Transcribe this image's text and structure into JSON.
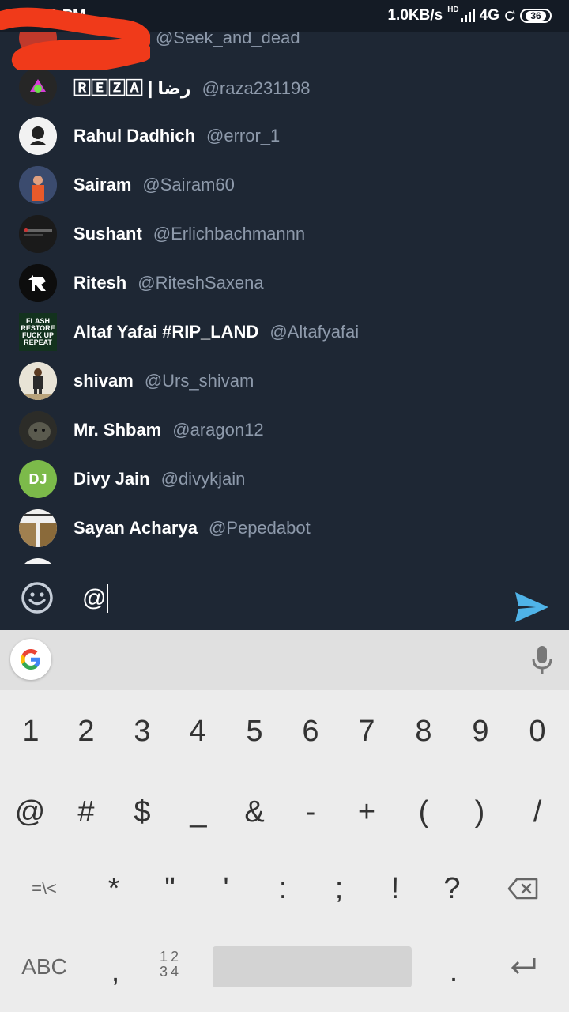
{
  "status_bar": {
    "time": "12:42 PM",
    "network_speed": "1.0KB/s",
    "hd_label": "HD",
    "network_type": "4G",
    "battery": "36"
  },
  "mentions": [
    {
      "name": "",
      "handle": "@Seek_and_dead",
      "avatar_color": "#c0392b"
    },
    {
      "name": "🅁🄴🅉🄰 | رضا",
      "handle": "@raza231198",
      "avatar_color": "#2b2b2b"
    },
    {
      "name": "Rahul Dadhich",
      "handle": "@error_1",
      "avatar_color": "#f2f2f2"
    },
    {
      "name": "Sairam",
      "handle": "@Sairam60",
      "avatar_color": "#3b4b6e"
    },
    {
      "name": "Sushant",
      "handle": "@Erlichbachmannn",
      "avatar_color": "#1a1a1a"
    },
    {
      "name": "Ritesh",
      "handle": "@RiteshSaxena",
      "avatar_color": "#0d0d0d"
    },
    {
      "name": "Altaf Yafai #RIP_LAND",
      "handle": "@Altafyafai",
      "avatar_color": "#13321e",
      "avatar_text": "FLASH RESTORE FUCK UP REPEAT"
    },
    {
      "name": "shivam",
      "handle": "@Urs_shivam",
      "avatar_color": "#e8e3d6"
    },
    {
      "name": "Mr. Shbam",
      "handle": "@aragon12",
      "avatar_color": "#3a3a36"
    },
    {
      "name": "Divy Jain",
      "handle": "@divykjain",
      "avatar_color": "#7cba4a",
      "avatar_text": "DJ"
    },
    {
      "name": "Sayan Acharya",
      "handle": "@Pepedabot",
      "avatar_color": "#8a7a5a"
    }
  ],
  "compose": {
    "text": "@"
  },
  "keyboard": {
    "row1": [
      "1",
      "2",
      "3",
      "4",
      "5",
      "6",
      "7",
      "8",
      "9",
      "0"
    ],
    "row2": [
      "@",
      "#",
      "$",
      "_",
      "&",
      "-",
      "+",
      "(",
      ")",
      "/"
    ],
    "row3": [
      "=\\<",
      "*",
      "\"",
      "'",
      ":",
      ";",
      "!",
      "?"
    ],
    "abc_label": "ABC",
    "comma": ",",
    "numpad_label": "12 34",
    "period": "."
  },
  "colors": {
    "background": "#1e2734",
    "name": "#ffffff",
    "handle": "#8e9aab",
    "send": "#4fb3e8"
  }
}
